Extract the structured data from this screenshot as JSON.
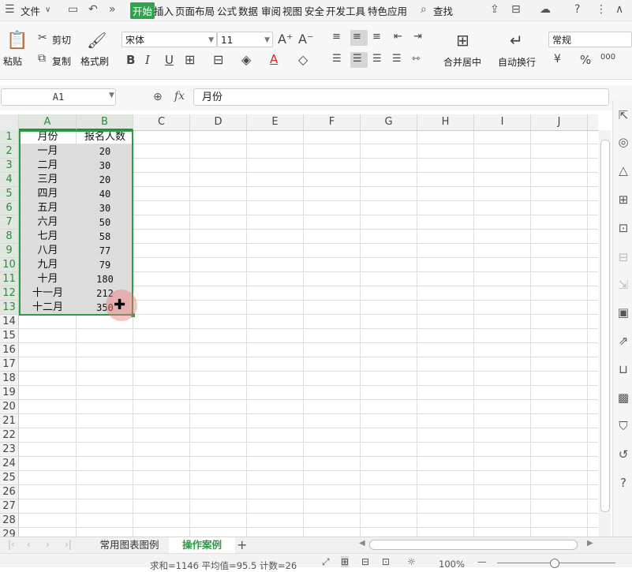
{
  "menubar": {
    "file": "文件",
    "tabs": [
      "开始",
      "插入",
      "页面布局",
      "公式",
      "数据",
      "审阅",
      "视图",
      "安全",
      "开发工具",
      "特色应用"
    ],
    "search": "查找"
  },
  "ribbon": {
    "paste": "粘贴",
    "cut": "剪切",
    "copy": "复制",
    "format_painter": "格式刷",
    "font_name": "宋体",
    "font_size": "11",
    "bold": "B",
    "italic": "I",
    "underline": "U",
    "font_color": "A",
    "merge_center": "合并居中",
    "wrap_text": "自动换行",
    "number_format": "常规",
    "currency": "¥",
    "percent": "%",
    "thousands": "000"
  },
  "formula_bar": {
    "name_box": "A1",
    "fx": "fx",
    "content": "月份"
  },
  "columns": [
    "A",
    "B",
    "C",
    "D",
    "E",
    "F",
    "G",
    "H",
    "I",
    "J"
  ],
  "rows": [
    "1",
    "2",
    "3",
    "4",
    "5",
    "6",
    "7",
    "8",
    "9",
    "10",
    "11",
    "12",
    "13",
    "14",
    "15",
    "16",
    "17",
    "18",
    "19",
    "20",
    "21",
    "22",
    "23",
    "24",
    "25",
    "26",
    "27",
    "28",
    "29"
  ],
  "table": {
    "headers": [
      "月份",
      "报名人数"
    ],
    "data": [
      [
        "一月",
        "20"
      ],
      [
        "二月",
        "30"
      ],
      [
        "三月",
        "20"
      ],
      [
        "四月",
        "40"
      ],
      [
        "五月",
        "30"
      ],
      [
        "六月",
        "50"
      ],
      [
        "七月",
        "58"
      ],
      [
        "八月",
        "77"
      ],
      [
        "九月",
        "79"
      ],
      [
        "十月",
        "180"
      ],
      [
        "十一月",
        "212"
      ],
      [
        "十二月",
        "350"
      ]
    ]
  },
  "sheets": {
    "tab1": "常用图表图例",
    "tab2": "操作案例"
  },
  "status": {
    "summary": "求和=1146  平均值=95.5  计数=26",
    "zoom": "100%"
  },
  "colors": {
    "accent": "#2fa44f",
    "selection": "#2f9a45",
    "selected_fill": "#dcdcdc"
  }
}
